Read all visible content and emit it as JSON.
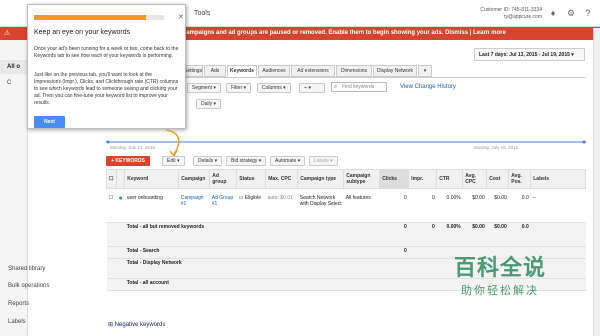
{
  "topbar": {
    "tools_label": "Tools",
    "customer_id": "Customer ID: 745-811-3334",
    "customer_email": "ty@appcure.com"
  },
  "alert": {
    "text": "campaigns and ad groups are paused or removed. Enable them to begin showing your ads.",
    "dismiss": "Dismiss",
    "learn_more": "Learn more",
    "separator": "|"
  },
  "sidebar": {
    "all_label": "All o",
    "c_label": "C",
    "shared_library": "Shared library",
    "bulk_operations": "Bulk operations",
    "reports": "Reports",
    "labels": "Labels",
    "negative_keywords": "Negative keywords"
  },
  "date_range": "Last 7 days: Jul 13, 2015 - Jul 19, 2015",
  "tabs": [
    {
      "label": "Settings",
      "active": false
    },
    {
      "label": "Ads",
      "active": false
    },
    {
      "label": "Keywords",
      "active": true
    },
    {
      "label": "Audiences",
      "active": false
    },
    {
      "label": "Ad extensions",
      "active": false
    },
    {
      "label": "Dimensions",
      "active": false
    },
    {
      "label": "Display Network",
      "active": false
    }
  ],
  "filters": {
    "segment": "Segment",
    "filter": "Filter",
    "columns": "Columns",
    "search_placeholder": "Find keywords",
    "view_change_history": "View Change History",
    "daily": "Daily"
  },
  "chart_dates": {
    "start": "Monday, July 13, 2015",
    "end": "Sunday, July 19, 2015"
  },
  "actions": {
    "keywords_button": "+ KEYWORDS",
    "edit": "Edit",
    "details": "Details",
    "bid_strategy": "Bid strategy",
    "automate": "Automate",
    "labels": "Labels"
  },
  "table": {
    "headers": [
      "",
      "",
      "Keyword",
      "Campaign",
      "Ad group",
      "Status",
      "Max. CPC",
      "Campaign type",
      "Campaign subtype",
      "Clicks",
      "Impr.",
      "CTR",
      "Avg. CPC",
      "Cost",
      "Avg. Pos.",
      "Labels"
    ],
    "row": {
      "keyword": "user onboarding",
      "campaign": "Campaign #1",
      "ad_group": "Ad Group #1",
      "status": "Eligible",
      "max_cpc": "auto: $0.01",
      "campaign_type": "Search Network with Display Select",
      "campaign_subtype": "All features",
      "clicks": "0",
      "impr": "0",
      "ctr": "0.00%",
      "avg_cpc": "$0.00",
      "cost": "$0.00",
      "avg_pos": "0.0",
      "labels": "--"
    },
    "totals": [
      {
        "label": "Total - all but removed keywords",
        "clicks": "0",
        "impr": "0",
        "ctr": "0.00%",
        "avg_cpc": "$0.00",
        "cost": "$0.00",
        "avg_pos": "0.0"
      },
      {
        "label": "Total - Search",
        "clicks": "0",
        "impr": "",
        "ctr": "",
        "avg_cpc": "",
        "cost": "",
        "avg_pos": ""
      },
      {
        "label": "Total - Display Network",
        "clicks": "",
        "impr": "",
        "ctr": "",
        "avg_cpc": "",
        "cost": "",
        "avg_pos": ""
      },
      {
        "label": "Total - all account",
        "clicks": "",
        "impr": "",
        "ctr": "",
        "avg_cpc": "",
        "cost": "",
        "avg_pos": ""
      }
    ]
  },
  "popup": {
    "progress": 0.86,
    "title": "Keep an eye on your keywords",
    "para1": "Once your ad's been running for a week or two, come back to the Keywords tab to see how each of your keywords is performing.",
    "para2": "Just like on the previous tab, you'll want to look at the Impressions (Impr.), Clicks, and Clickthrough rate (CTR) columns to see which keywords lead to someone seeing and clicking your ad. Then you can fine-tune your keyword list to improve your results.",
    "next_label": "Next"
  },
  "watermark": {
    "big": "百科全说",
    "small": "助你轻松解决"
  },
  "colors": {
    "accent_red": "#d9442e",
    "next_blue": "#4b8bf4",
    "progress_orange": "#f09b22",
    "chart_line": "#4a7fd4"
  }
}
